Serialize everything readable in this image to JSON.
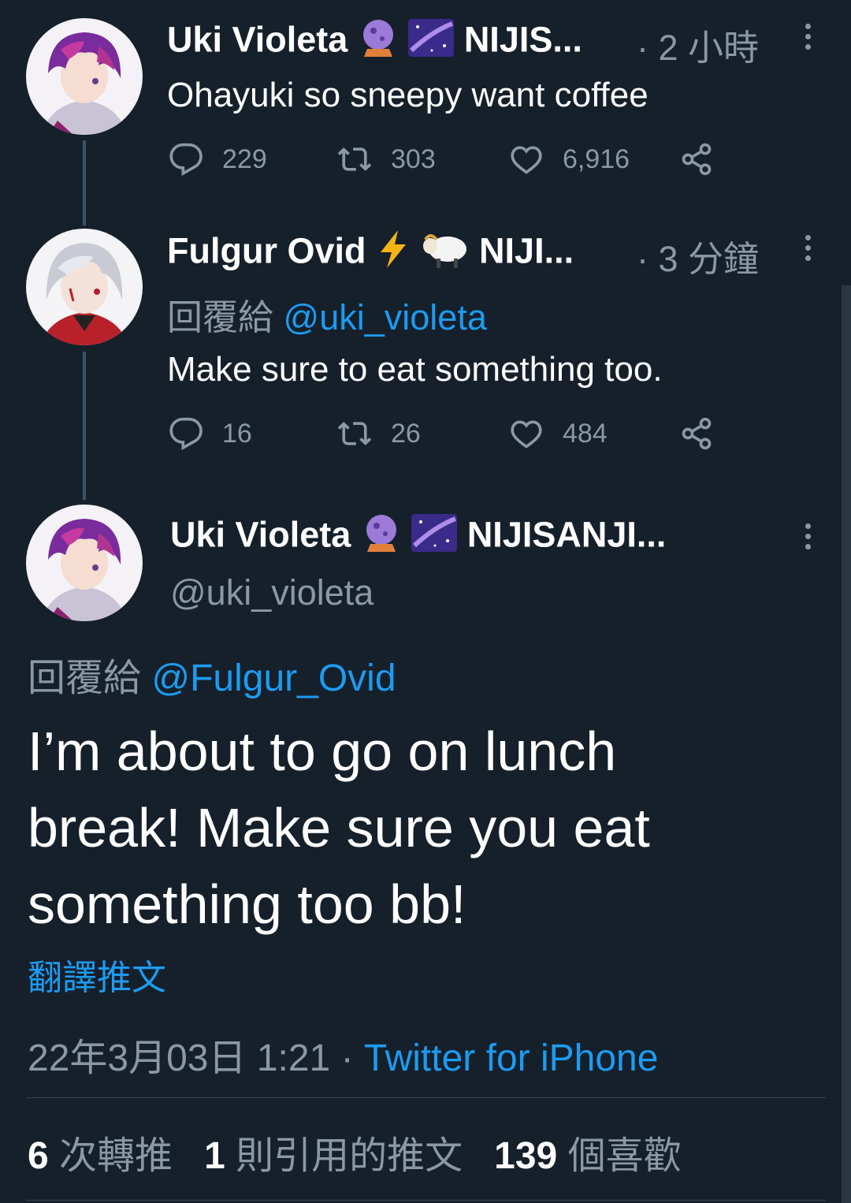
{
  "tweet1": {
    "name": "Uki Violeta",
    "name_suffix": "NIJIS...",
    "time": "· 2 小時",
    "text": "Ohayuki so sneepy want coffee",
    "replies": "229",
    "retweets": "303",
    "likes": "6,916"
  },
  "tweet2": {
    "name": "Fulgur Ovid",
    "name_suffix": "NIJI...",
    "time": "· 3 分鐘",
    "reply_prefix": "回覆給",
    "reply_handle": "@uki_violeta",
    "text": "Make sure to eat something too.",
    "replies": "16",
    "retweets": "26",
    "likes": "484"
  },
  "main": {
    "name": "Uki Violeta",
    "name_suffix": "NIJISANJI...",
    "handle": "@uki_violeta",
    "reply_prefix": "回覆給",
    "reply_handle": "@Fulgur_Ovid",
    "text_line1": "I’m about to go on lunch",
    "text_line2": "break! Make sure you eat",
    "text_line3": "something too bb!",
    "translate": "翻譯推文",
    "timestamp": "22年3月03日 1:21",
    "dot": "·",
    "source": "Twitter for iPhone",
    "retweet_count": "6",
    "retweet_label": "次轉推",
    "quote_count": "1",
    "quote_label": "則引用的推文",
    "like_count": "139",
    "like_label": "個喜歡"
  },
  "icons": [
    "reply-icon",
    "retweet-icon",
    "like-icon",
    "share-icon",
    "more-icon",
    "crystal-ball-emoji",
    "galaxy-emoji",
    "lightning-emoji",
    "sheep-emoji"
  ],
  "colors": {
    "background": "#15202b",
    "link": "#1d9bf0",
    "muted": "#8b98a5"
  }
}
